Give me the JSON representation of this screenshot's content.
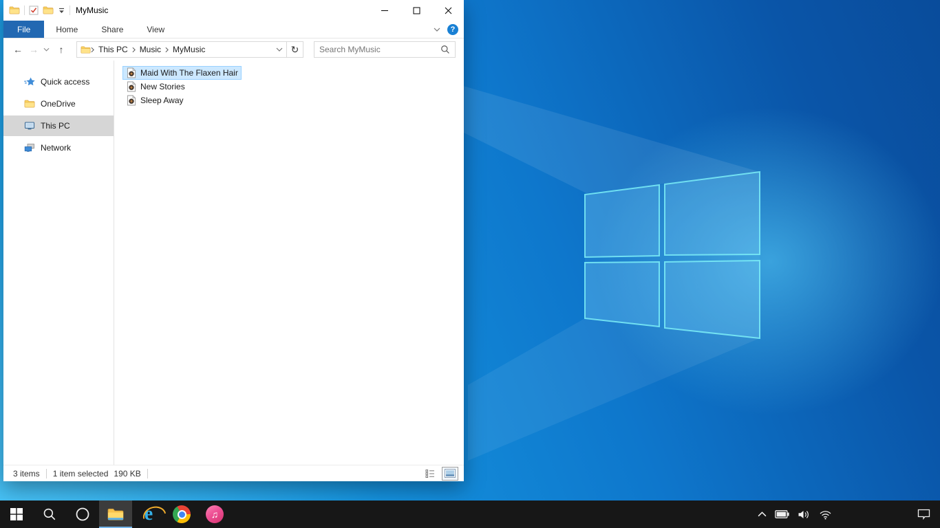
{
  "window": {
    "title": "MyMusic",
    "quick_access_toolbar": {
      "icons": [
        "explorer-folder-icon",
        "properties-check-icon",
        "new-folder-icon",
        "customize-qat-arrow-icon"
      ]
    },
    "caption_buttons": [
      "minimize",
      "maximize",
      "close"
    ],
    "ribbon": {
      "tabs": [
        {
          "label": "File",
          "active": true
        },
        {
          "label": "Home",
          "active": false
        },
        {
          "label": "Share",
          "active": false
        },
        {
          "label": "View",
          "active": false
        }
      ],
      "right_icons": [
        "expand-ribbon-chevron-icon",
        "help-icon"
      ]
    },
    "address": {
      "nav_icons": [
        "back-arrow",
        "forward-arrow",
        "recent-locations-chevron",
        "up-arrow"
      ],
      "breadcrumbs": [
        {
          "label": "This PC"
        },
        {
          "label": "Music"
        },
        {
          "label": "MyMusic"
        }
      ],
      "controls": [
        "address-dropdown-chevron",
        "refresh"
      ],
      "refresh_glyph": "↻"
    },
    "search": {
      "placeholder": "Search MyMusic"
    },
    "sidebar": {
      "items": [
        {
          "label": "Quick access",
          "icon": "quick-access-star-icon",
          "selected": false
        },
        {
          "label": "OneDrive",
          "icon": "folder-icon",
          "selected": false
        },
        {
          "label": "This PC",
          "icon": "monitor-icon",
          "selected": true
        },
        {
          "label": "Network",
          "icon": "network-icon",
          "selected": false
        }
      ]
    },
    "files": [
      {
        "name": "Maid With The Flaxen Hair",
        "icon": "audio-file-icon",
        "selected": true
      },
      {
        "name": "New Stories",
        "icon": "audio-file-icon",
        "selected": false
      },
      {
        "name": "Sleep Away",
        "icon": "audio-file-icon",
        "selected": false
      }
    ],
    "statusbar": {
      "count": "3 items",
      "selection": "1 item selected",
      "size": "190 KB",
      "view_buttons": [
        "details-view-icon",
        "large-icons-view-icon"
      ],
      "active_view": "large-icons-view-icon"
    }
  },
  "taskbar": {
    "buttons": [
      {
        "name": "start",
        "icon": "windows-logo-icon"
      },
      {
        "name": "search",
        "icon": "search-icon"
      },
      {
        "name": "cortana",
        "icon": "cortana-circle-icon"
      },
      {
        "name": "file-explorer",
        "icon": "folder-icon",
        "active": true
      },
      {
        "name": "internet-explorer",
        "icon": "ie-icon"
      },
      {
        "name": "chrome",
        "icon": "chrome-icon"
      },
      {
        "name": "itunes",
        "icon": "music-note-icon",
        "glyph": "♫"
      }
    ],
    "tray": [
      "hidden-icons-chevron-icon",
      "battery-icon",
      "volume-icon",
      "wifi-icon",
      "action-center-icon"
    ]
  },
  "colors": {
    "accent": "#0078d7",
    "file_tab_blue": "#2268b2",
    "selection_bg": "#cce8ff",
    "selection_border": "#99d1ff",
    "nav_selected_bg": "#d6d6d6",
    "taskbar_bg": "#171717",
    "taskbar_active_underline": "#75b6ea",
    "help_icon_blue": "#1980d4"
  }
}
